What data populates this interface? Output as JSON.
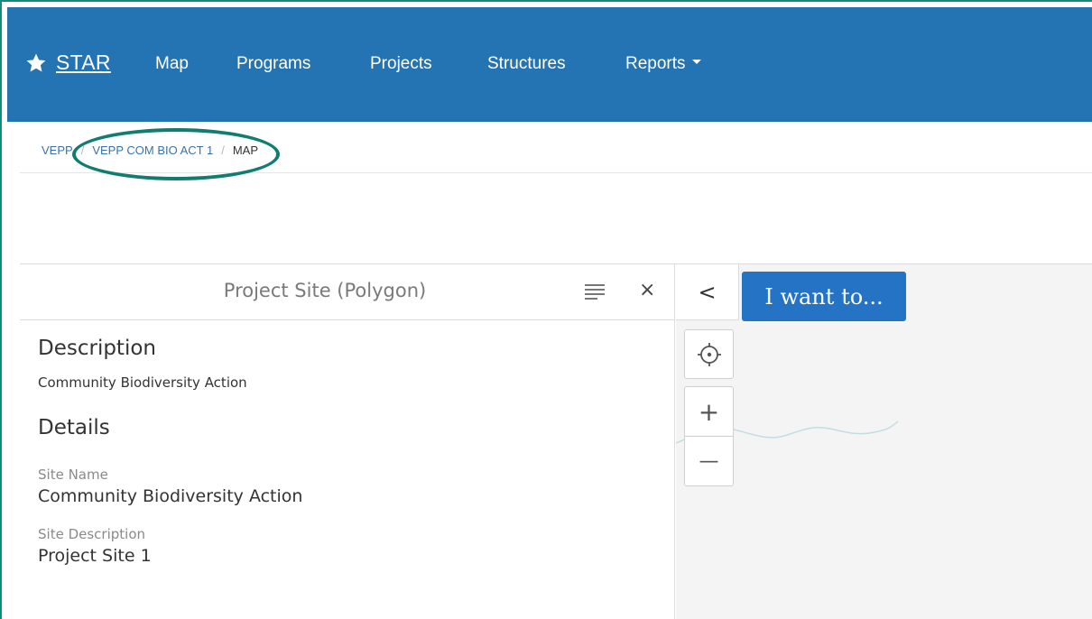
{
  "navbar": {
    "brand_label": "STAR",
    "items": [
      {
        "label": "Map"
      },
      {
        "label": "Programs"
      },
      {
        "label": "Projects"
      },
      {
        "label": "Structures"
      },
      {
        "label": "Reports"
      }
    ]
  },
  "breadcrumb": {
    "items": [
      {
        "label": "VEPP"
      },
      {
        "label": "VEPP COM BIO ACT 1"
      },
      {
        "label": "MAP"
      }
    ],
    "separator": "/"
  },
  "panel": {
    "title": "Project Site (Polygon)",
    "description_heading": "Description",
    "description_text": "Community Biodiversity Action",
    "details_heading": "Details",
    "fields": [
      {
        "label": "Site Name",
        "value": "Community Biodiversity Action"
      },
      {
        "label": "Site Description",
        "value": "Project Site 1"
      }
    ]
  },
  "map": {
    "collapse_label": "<",
    "i_want_to_label": "I want to...",
    "zoom_in_label": "+",
    "zoom_out_label": "—"
  },
  "colors": {
    "navbar": "#2474b3",
    "accent_button": "#2573c5",
    "highlight": "#117c70"
  }
}
